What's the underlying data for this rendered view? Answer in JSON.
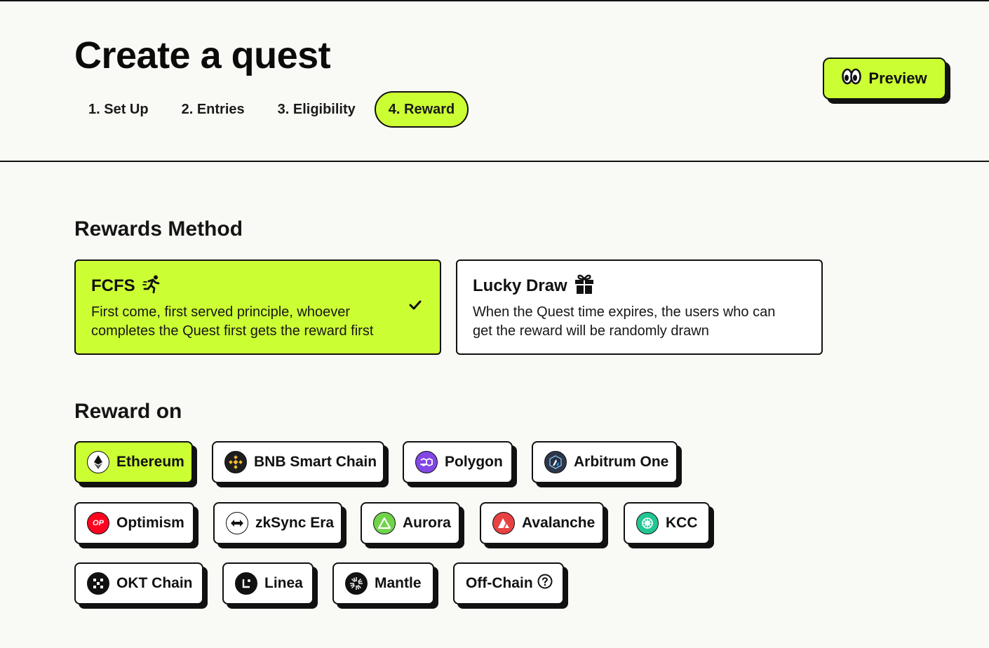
{
  "page": {
    "title": "Create a quest",
    "preview_label": "Preview"
  },
  "tabs": [
    {
      "label": "1. Set Up",
      "active": false
    },
    {
      "label": "2. Entries",
      "active": false
    },
    {
      "label": "3. Eligibility",
      "active": false
    },
    {
      "label": "4. Reward",
      "active": true
    }
  ],
  "rewards_method": {
    "heading": "Rewards Method",
    "options": [
      {
        "title": "FCFS",
        "icon": "running-person-icon",
        "description": "First come, first served principle, whoever completes the Quest first gets the reward first",
        "selected": true
      },
      {
        "title": "Lucky Draw",
        "icon": "gift-icon",
        "description": "When the Quest time expires, the users who can get the reward will be randomly drawn",
        "selected": false
      }
    ]
  },
  "reward_on": {
    "heading": "Reward on",
    "chains": [
      {
        "label": "Ethereum",
        "icon": "ethereum-icon",
        "color": "#ffffff",
        "selected": true
      },
      {
        "label": "BNB Smart Chain",
        "icon": "bnb-icon",
        "color": "#1e1e1e",
        "selected": false
      },
      {
        "label": "Polygon",
        "icon": "polygon-icon",
        "color": "#8247e5",
        "selected": false
      },
      {
        "label": "Arbitrum One",
        "icon": "arbitrum-icon",
        "color": "#2d374b",
        "selected": false
      },
      {
        "label": "Optimism",
        "icon": "optimism-icon",
        "color": "#ff0420",
        "selected": false
      },
      {
        "label": "zkSync Era",
        "icon": "zksync-icon",
        "color": "#ffffff",
        "selected": false
      },
      {
        "label": "Aurora",
        "icon": "aurora-icon",
        "color": "#70d44b",
        "selected": false
      },
      {
        "label": "Avalanche",
        "icon": "avalanche-icon",
        "color": "#e84142",
        "selected": false
      },
      {
        "label": "KCC",
        "icon": "kcc-icon",
        "color": "#21c694",
        "selected": false
      },
      {
        "label": "OKT Chain",
        "icon": "okt-icon",
        "color": "#111111",
        "selected": false
      },
      {
        "label": "Linea",
        "icon": "linea-icon",
        "color": "#111111",
        "selected": false
      },
      {
        "label": "Mantle",
        "icon": "mantle-icon",
        "color": "#111111",
        "selected": false
      },
      {
        "label": "Off-Chain",
        "icon": "help-circle-icon",
        "color": "#ffffff",
        "selected": false
      }
    ]
  },
  "icons": {
    "optimism_text": "OP"
  },
  "theme": {
    "accent": "#ccff33",
    "background": "#f9f9f5",
    "border": "#111111"
  }
}
